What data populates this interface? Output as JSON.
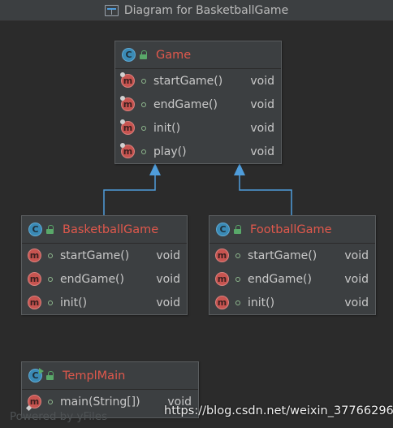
{
  "window": {
    "title": "Diagram for BasketballGame"
  },
  "classes": {
    "game": {
      "icon": "class-icon",
      "icon_letter": "C",
      "name": "Game",
      "methods": [
        {
          "icon_letter": "m",
          "name": "startGame()",
          "type": "void"
        },
        {
          "icon_letter": "m",
          "name": "endGame()",
          "type": "void"
        },
        {
          "icon_letter": "m",
          "name": "init()",
          "type": "void"
        },
        {
          "icon_letter": "m",
          "name": "play()",
          "type": "void"
        }
      ]
    },
    "basketball": {
      "icon": "class-icon",
      "icon_letter": "C",
      "name": "BasketballGame",
      "methods": [
        {
          "icon_letter": "m",
          "name": "startGame()",
          "type": "void"
        },
        {
          "icon_letter": "m",
          "name": "endGame()",
          "type": "void"
        },
        {
          "icon_letter": "m",
          "name": "init()",
          "type": "void"
        }
      ]
    },
    "football": {
      "icon": "class-icon",
      "icon_letter": "C",
      "name": "FootballGame",
      "methods": [
        {
          "icon_letter": "m",
          "name": "startGame()",
          "type": "void"
        },
        {
          "icon_letter": "m",
          "name": "endGame()",
          "type": "void"
        },
        {
          "icon_letter": "m",
          "name": "init()",
          "type": "void"
        }
      ]
    },
    "templmain": {
      "icon": "runnable-class-icon",
      "icon_letter": "C",
      "name": "TemplMain",
      "methods": [
        {
          "icon_letter": "m",
          "name": "main(String[])",
          "type": "void"
        }
      ]
    }
  },
  "footer": {
    "powered_by": "Powered by yFiles",
    "source_watermark": "https://blog.csdn.net/weixin_37766296"
  },
  "colors": {
    "background": "#2b2b2b",
    "node_background": "#3c3f41",
    "class_name": "#e0584c",
    "inheritance_arrow": "#4f9ddb"
  }
}
